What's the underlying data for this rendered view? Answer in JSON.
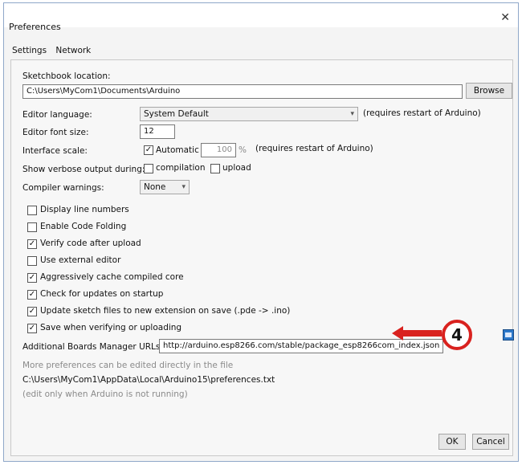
{
  "window": {
    "title": "Preferences",
    "close_glyph": "✕"
  },
  "tabs": [
    {
      "label": "Settings"
    },
    {
      "label": "Network"
    }
  ],
  "sketchbook": {
    "label": "Sketchbook location:",
    "value": "C:\\Users\\MyCom1\\Documents\\Arduino",
    "browse": "Browse"
  },
  "editor_language": {
    "label": "Editor language:",
    "value": "System Default",
    "note": "(requires restart of Arduino)"
  },
  "editor_font_size": {
    "label": "Editor font size:",
    "value": "12"
  },
  "interface_scale": {
    "label": "Interface scale:",
    "automatic_label": "Automatic",
    "value": "100",
    "unit": "%",
    "note": "(requires restart of Arduino)"
  },
  "verbose_output": {
    "label": "Show verbose output during:",
    "compilation": "compilation",
    "upload": "upload"
  },
  "compiler_warnings": {
    "label": "Compiler warnings:",
    "value": "None"
  },
  "options": [
    {
      "label": "Display line numbers",
      "checked": false
    },
    {
      "label": "Enable Code Folding",
      "checked": false
    },
    {
      "label": "Verify code after upload",
      "checked": true
    },
    {
      "label": "Use external editor",
      "checked": false
    },
    {
      "label": "Aggressively cache compiled core",
      "checked": true
    },
    {
      "label": "Check for updates on startup",
      "checked": true
    },
    {
      "label": "Update sketch files to new extension on save (.pde -> .ino)",
      "checked": true
    },
    {
      "label": "Save when verifying or uploading",
      "checked": true
    }
  ],
  "boards_manager": {
    "label": "Additional Boards Manager URLs:",
    "value": "http://arduino.esp8266.com/stable/package_esp8266com_index.json"
  },
  "info": {
    "more_prefs": "More preferences can be edited directly in the file",
    "path": "C:\\Users\\MyCom1\\AppData\\Local\\Arduino15\\preferences.txt",
    "edit_note": "(edit only when Arduino is not running)"
  },
  "annotation": {
    "step": "4",
    "color": "#d9221f"
  },
  "buttons": {
    "ok": "OK",
    "cancel": "Cancel"
  },
  "icons": {
    "close": "close-icon",
    "window": "window-icon",
    "dropdown": "chevron-down-icon",
    "check": "checkmark-icon"
  }
}
